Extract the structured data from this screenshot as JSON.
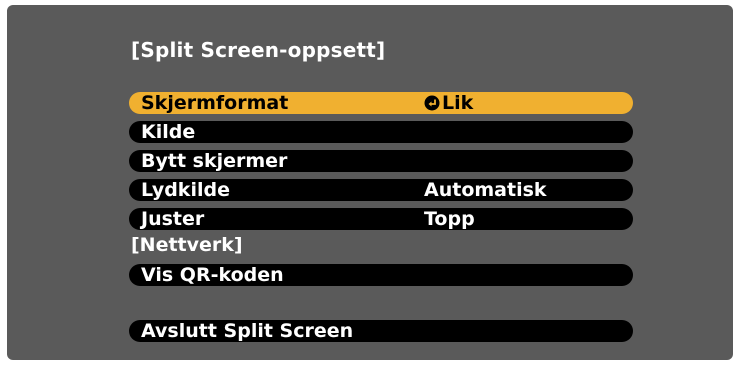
{
  "osd": {
    "title": "[Split Screen-oppsett]",
    "colors": {
      "background": "#5a5a5a",
      "row": "#000000",
      "selected_row": "#f0b030",
      "text": "#ffffff",
      "selected_text": "#000000"
    },
    "rows": [
      {
        "label": "Skjermformat",
        "value": "Lik",
        "selected": true,
        "icon": "enter-icon"
      },
      {
        "label": "Kilde",
        "value": ""
      },
      {
        "label": "Bytt skjermer",
        "value": ""
      },
      {
        "label": "Lydkilde",
        "value": "Automatisk"
      },
      {
        "label": "Juster",
        "value": "Topp"
      }
    ],
    "network": {
      "header": "[Nettverk]",
      "rows": [
        {
          "label": "Vis QR-koden"
        }
      ]
    },
    "exit": {
      "label": "Avslutt Split Screen"
    }
  }
}
